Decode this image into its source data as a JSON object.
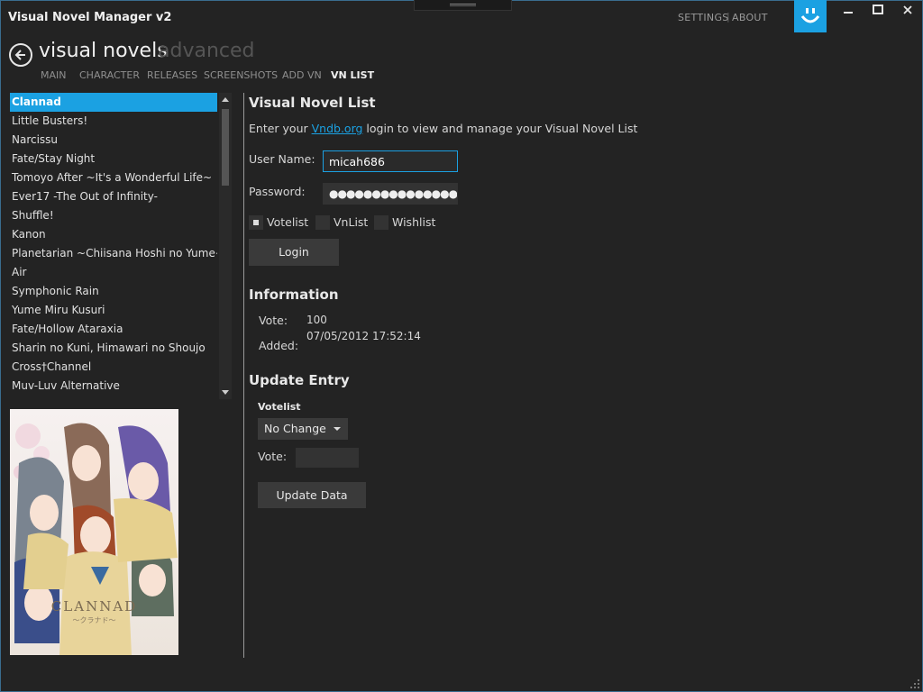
{
  "app": {
    "title": "Visual Novel Manager v2",
    "topnav": [
      "SETTINGS",
      "ABOUT"
    ],
    "accent": "#1ba1e2"
  },
  "header": {
    "main": "visual novels",
    "sub": "advanced",
    "tabs": [
      "MAIN",
      "CHARACTER",
      "RELEASES",
      "SCREENSHOTS",
      "ADD VN",
      "VN LIST"
    ],
    "active_tab": "VN LIST"
  },
  "vn_list": {
    "items": [
      "Clannad",
      "Little Busters!",
      "Narcissu",
      "Fate/Stay Night",
      "Tomoyo After ~It's a Wonderful Life~",
      "Ever17 -The Out of Infinity-",
      "Shuffle!",
      "Kanon",
      "Planetarian ~Chiisana Hoshi no Yume~",
      "Air",
      "Symphonic Rain",
      "Yume Miru Kusuri",
      "Fate/Hollow Ataraxia",
      "Sharin no Kuni, Himawari no Shoujo",
      "Cross†Channel",
      "Muv-Luv Alternative"
    ],
    "selected_index": 0
  },
  "cover": {
    "title": "CLANNAD",
    "subtitle": "～クラナド～"
  },
  "vnlist_panel": {
    "title": "Visual Novel List",
    "intro_before": "Enter your ",
    "intro_link": "Vndb.org",
    "intro_after": " login to view and manage your Visual Novel List",
    "username_label": "User Name:",
    "username_value": "micah686",
    "password_label": "Password:",
    "password_mask": "●●●●●●●●●●●●●●●●●●●●",
    "checkboxes": [
      {
        "label": "Votelist",
        "checked": true
      },
      {
        "label": "VnList",
        "checked": false
      },
      {
        "label": "Wishlist",
        "checked": false
      }
    ],
    "login_label": "Login"
  },
  "information": {
    "title": "Information",
    "vote_label": "Vote:",
    "vote_value": "100",
    "added_label": "Added:",
    "added_value": "07/05/2012 17:52:14"
  },
  "update": {
    "title": "Update Entry",
    "list_label": "Votelist",
    "select_value": "No Change",
    "vote_label": "Vote:",
    "vote_value": "",
    "button_label": "Update Data"
  }
}
